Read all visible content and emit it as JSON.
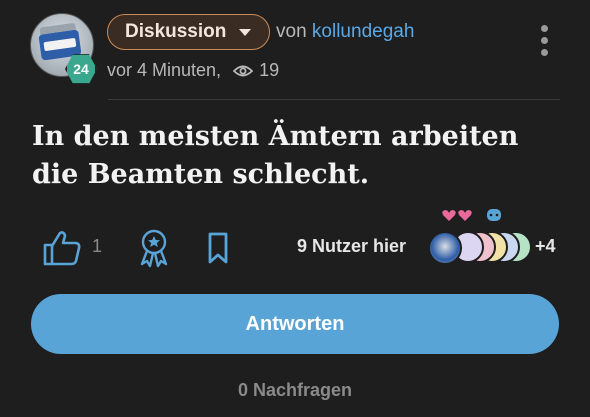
{
  "post": {
    "author": {
      "prefix": "von",
      "username": "kollundegah",
      "level": "24"
    },
    "category": "Diskussion",
    "time": "vor 4 Minuten,",
    "views": "19",
    "question": "In den meisten Ämtern arbeiten die Beamten schlecht."
  },
  "actions": {
    "likes": "1",
    "users_here_label": "9 Nutzer hier",
    "more_users": "+4"
  },
  "reply_button_label": "Antworten",
  "followups_label": "0 Nachfragen",
  "colors": {
    "background": "#1e1e1f",
    "category_border": "#c98b5a",
    "accent_blue": "#59a4d6",
    "link_blue": "#5aa9e6",
    "level_badge": "#3aa88e"
  },
  "icons": [
    "eye-icon",
    "more-vertical-icon",
    "thumbs-up-icon",
    "award-icon",
    "bookmark-icon",
    "chevron-down-icon"
  ]
}
